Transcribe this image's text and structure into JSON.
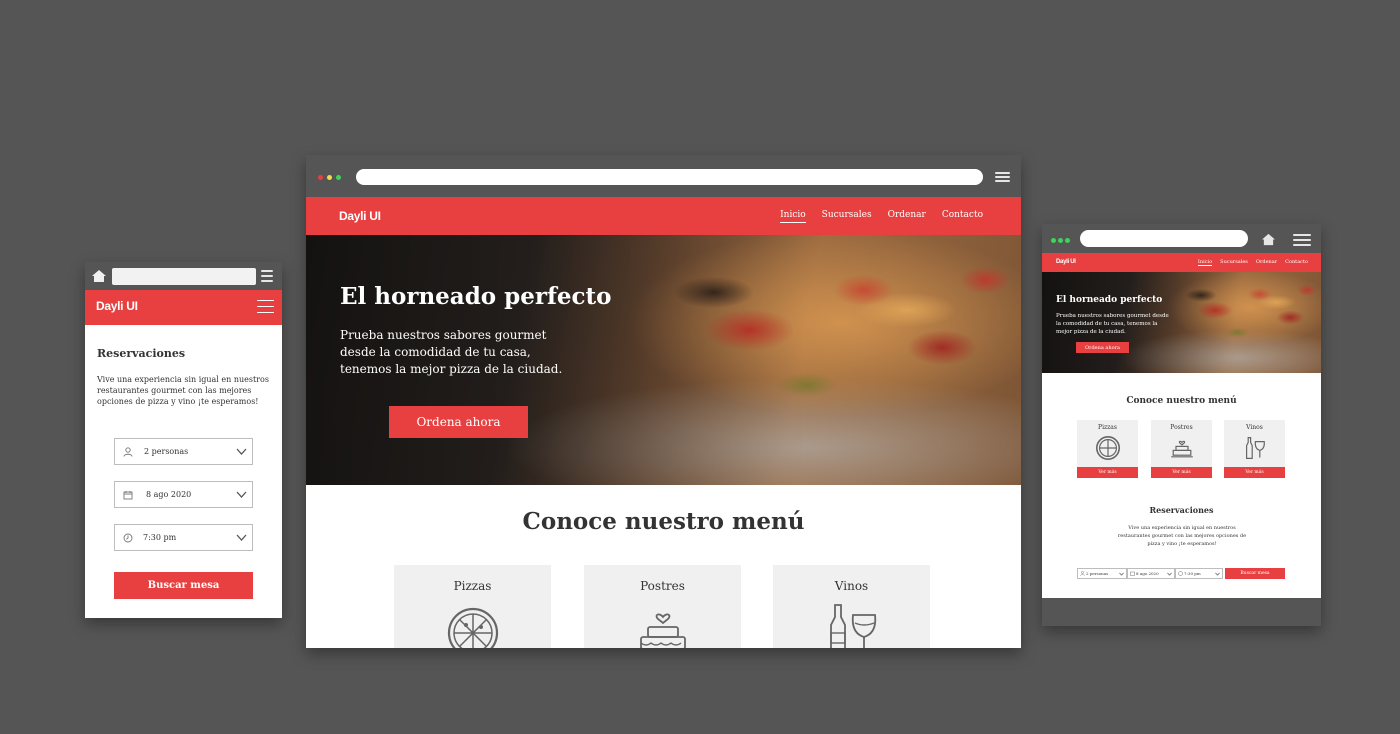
{
  "brand": "Dayli UI",
  "nav": {
    "links": [
      "Inicio",
      "Sucursales",
      "Ordenar",
      "Contacto"
    ]
  },
  "hero": {
    "title": "El horneado perfecto",
    "text": "Prueba nuestros sabores gourmet desde la comodidad de tu casa, tenemos la mejor pizza de la ciudad.",
    "cta": "Ordena ahora"
  },
  "menu": {
    "title": "Conoce nuestro menú",
    "items": [
      {
        "label": "Pizzas",
        "icon": "pizza-icon"
      },
      {
        "label": "Postres",
        "icon": "cake-icon"
      },
      {
        "label": "Vinos",
        "icon": "wine-icon"
      }
    ],
    "more": "Ver más"
  },
  "reservations": {
    "title": "Reservaciones",
    "text": "Vive una experiencia sin igual en nuestros restaurantes gourmet con las mejores opciones de pizza y vino ¡te esperamos!",
    "people": "2 personas",
    "date": "8 ago 2020",
    "time": "7:30 pm",
    "people_short": "2 personas",
    "date_short": "8 ago 2020",
    "time_short": "7:30 pm",
    "search": "Buscar mesa"
  },
  "colors": {
    "accent": "#e84040",
    "chrome": "#555555",
    "dots": [
      "#e84040",
      "#f2d94e",
      "#3fd35a"
    ],
    "tablet_dots": "#3fd35a"
  }
}
